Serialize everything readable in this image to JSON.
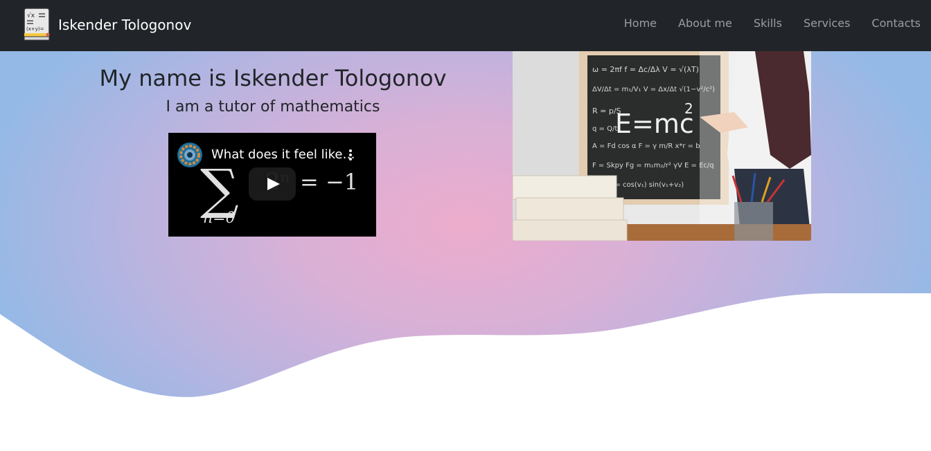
{
  "navbar": {
    "brand_name": "Iskender Tologonov",
    "logo_icon": "math-notebook-icon",
    "links": [
      {
        "label": "Home"
      },
      {
        "label": "About me"
      },
      {
        "label": "Skills"
      },
      {
        "label": "Services"
      },
      {
        "label": "Contacts"
      }
    ]
  },
  "hero": {
    "title": "My name is Iskender Tologonov",
    "subtitle": "I am a tutor of mathematics",
    "video": {
      "title": "What does it feel like…",
      "channel_icon": "channel-avatar-icon",
      "play_icon": "play-icon",
      "menu_icon": "more-vert-icon"
    },
    "photo_icon": "chalkboard-photo"
  },
  "colors": {
    "navbar_bg": "#212529",
    "nav_link": "rgba(255,255,255,0.55)",
    "gradient_center": "#ecaccc",
    "gradient_edge": "#95b9e6"
  }
}
